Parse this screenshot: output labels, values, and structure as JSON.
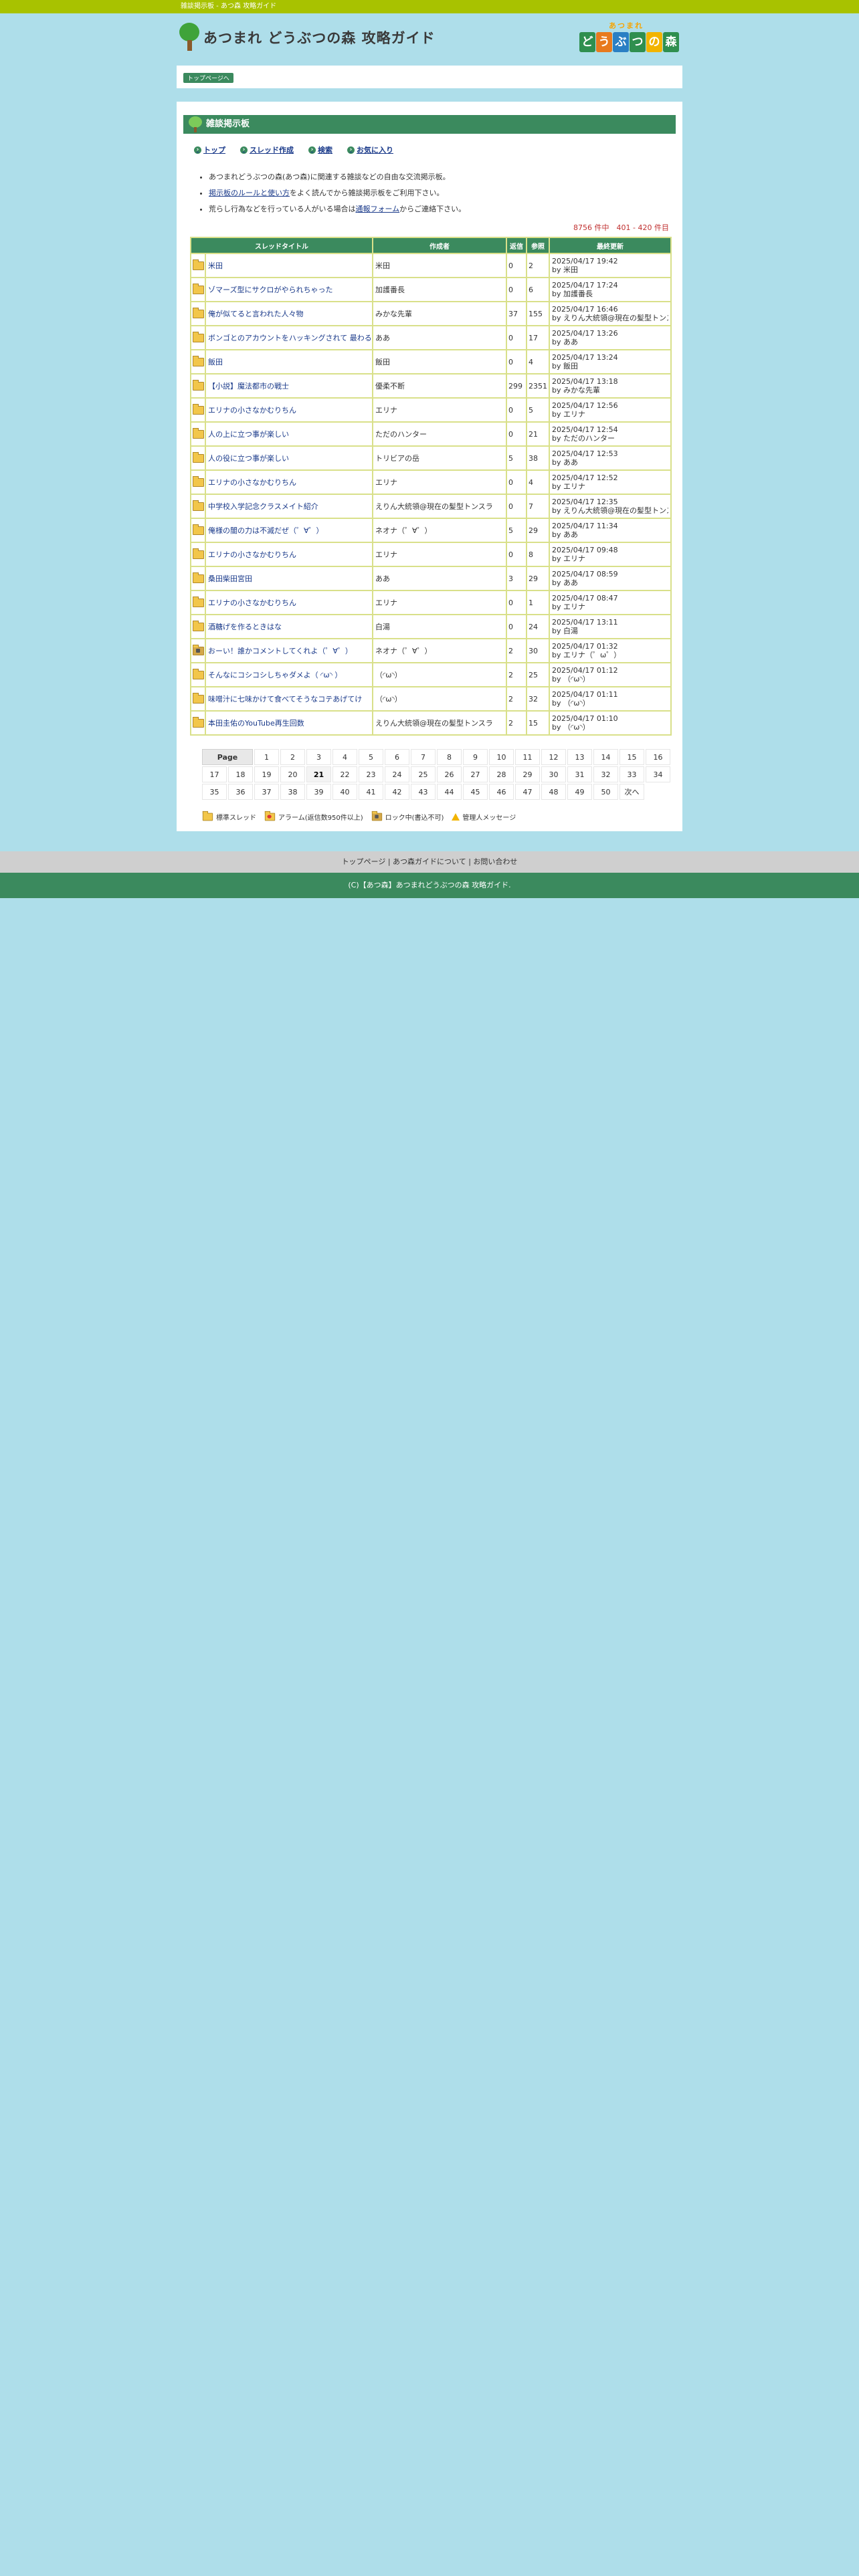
{
  "topbar": {
    "text": "雑談掲示板 - あつ森 攻略ガイド"
  },
  "header": {
    "title": "あつまれ どうぶつの森 攻略ガイド",
    "brand_top": "あつまれ",
    "brand_tiles": [
      {
        "ch": "ど",
        "color": "#2f8f4f"
      },
      {
        "ch": "う",
        "color": "#e87a1e"
      },
      {
        "ch": "ぶ",
        "color": "#2a7fc4"
      },
      {
        "ch": "つ",
        "color": "#2f8f4f"
      },
      {
        "ch": "の",
        "color": "#f2b400"
      },
      {
        "ch": "森",
        "color": "#2f8f4f"
      }
    ]
  },
  "nav": {
    "crumb": "トップページへ"
  },
  "board": {
    "heading": "雑談掲示板",
    "menu": [
      "トップ",
      "スレッド作成",
      "検索",
      "お気に入り"
    ],
    "notes": {
      "n1": "あつまれどうぶつの森(あつ森)に関連する雑談などの自由な交流掲示板。",
      "n2_link": "掲示板のルールと使い方",
      "n2_rest": "をよく読んでから雑談掲示板をご利用下さい。",
      "n3_pre": "荒らし行為などを行っている人がいる場合は",
      "n3_link": "通報フォーム",
      "n3_post": "からご連絡下さい。"
    },
    "count": "8756 件中　401 - 420 件目",
    "columns": [
      "スレッドタイトル",
      "作成者",
      "返信",
      "参照",
      "最終更新"
    ],
    "threads": [
      {
        "icon": "folder",
        "title": "米田",
        "author": "米田",
        "replies": "0",
        "views": "2",
        "date": "2025/04/17 19:42",
        "by": "by 米田"
      },
      {
        "icon": "folder",
        "title": "ゾマーズ型にサクロがやられちゃった",
        "author": "加護番長",
        "replies": "0",
        "views": "6",
        "date": "2025/04/17 17:24",
        "by": "by 加護番長"
      },
      {
        "icon": "folder",
        "title": "俺が似てると言われた人々物",
        "author": "みかな先輩",
        "replies": "37",
        "views": "155",
        "date": "2025/04/17 16:46",
        "by": "by えりん大統領@現在の髪型トンスラ"
      },
      {
        "icon": "folder",
        "title": "ボンゴとのアカウントをハッキングされて \n 最わるう〜くん",
        "author": "ああ",
        "replies": "0",
        "views": "17",
        "date": "2025/04/17 13:26",
        "by": "by ああ"
      },
      {
        "icon": "folder",
        "title": "飯田",
        "author": "飯田",
        "replies": "0",
        "views": "4",
        "date": "2025/04/17 13:24",
        "by": "by 飯田"
      },
      {
        "icon": "folder",
        "title": "【小説】魔法都市の戦士",
        "author": "優柔不断",
        "replies": "299",
        "views": "2351",
        "date": "2025/04/17 13:18",
        "by": "by みかな先輩"
      },
      {
        "icon": "folder",
        "title": "エリナの小さなかむりちん",
        "author": "エリナ",
        "replies": "0",
        "views": "5",
        "date": "2025/04/17 12:56",
        "by": "by エリナ"
      },
      {
        "icon": "folder",
        "title": "人の上に立つ事が楽しい",
        "author": "ただのハンター",
        "replies": "0",
        "views": "21",
        "date": "2025/04/17 12:54",
        "by": "by ただのハンター"
      },
      {
        "icon": "folder",
        "title": "人の役に立つ事が楽しい",
        "author": "トリビアの岳",
        "replies": "5",
        "views": "38",
        "date": "2025/04/17 12:53",
        "by": "by ああ"
      },
      {
        "icon": "folder",
        "title": "エリナの小さなかむりちん",
        "author": "エリナ",
        "replies": "0",
        "views": "4",
        "date": "2025/04/17 12:52",
        "by": "by エリナ"
      },
      {
        "icon": "folder",
        "title": "中学校入学記念クラスメイト紹介",
        "author": "えりん大統領@現在の髪型トンスラ",
        "replies": "0",
        "views": "7",
        "date": "2025/04/17 12:35",
        "by": "by えりん大統領@現在の髪型トンスラ"
      },
      {
        "icon": "folder",
        "title": "俺様の闇の力は不滅だぜ（゜∀゜）",
        "author": "ネオナ（゜∀゜）",
        "replies": "5",
        "views": "29",
        "date": "2025/04/17 11:34",
        "by": "by ああ"
      },
      {
        "icon": "folder",
        "title": "エリナの小さなかむりちん",
        "author": "エリナ",
        "replies": "0",
        "views": "8",
        "date": "2025/04/17 09:48",
        "by": "by エリナ"
      },
      {
        "icon": "folder",
        "title": "桑田柴田宮田",
        "author": "ああ",
        "replies": "3",
        "views": "29",
        "date": "2025/04/17 08:59",
        "by": "by ああ"
      },
      {
        "icon": "folder",
        "title": "エリナの小さなかむりちん",
        "author": "エリナ",
        "replies": "0",
        "views": "1",
        "date": "2025/04/17 08:47",
        "by": "by エリナ"
      },
      {
        "icon": "folder",
        "title": "酒糖げを作るときはな",
        "author": "白湯",
        "replies": "0",
        "views": "24",
        "date": "2025/04/17 13:11",
        "by": "by 白湯"
      },
      {
        "icon": "lock",
        "title": "おーい！誰かコメントしてくれよ（゜∀゜）",
        "author": "ネオナ（゜∀゜）",
        "replies": "2",
        "views": "30",
        "date": "2025/04/17 01:32",
        "by": "by エリナ（゜ω゜）"
      },
      {
        "icon": "folder",
        "title": "そんなにコシコシしちゃダメよ（ ◜ω◝ ）",
        "author": "（◜ω◝）",
        "replies": "2",
        "views": "25",
        "date": "2025/04/17 01:12",
        "by": "by （◜ω◝）"
      },
      {
        "icon": "folder",
        "title": "味噌汁に七味かけて食べてそうなコテあげてけ",
        "author": "（◜ω◝）",
        "replies": "2",
        "views": "32",
        "date": "2025/04/17 01:11",
        "by": "by （◜ω◝）"
      },
      {
        "icon": "folder",
        "title": "本田圭佑のYouTube再生回数",
        "author": "えりん大統領@現在の髪型トンスラ",
        "replies": "2",
        "views": "15",
        "date": "2025/04/17 01:10",
        "by": "by （◜ω◝）"
      }
    ],
    "pager": {
      "label": "Page",
      "rows": [
        [
          "1",
          "2",
          "3",
          "4",
          "5",
          "6",
          "7",
          "8",
          "9",
          "10",
          "11",
          "12",
          "13",
          "14",
          "15",
          "16"
        ],
        [
          "17",
          "18",
          "19",
          "20",
          "21",
          "22",
          "23",
          "24",
          "25",
          "26",
          "27",
          "28",
          "29",
          "30",
          "31",
          "32",
          "33",
          "34"
        ],
        [
          "35",
          "36",
          "37",
          "38",
          "39",
          "40",
          "41",
          "42",
          "43",
          "44",
          "45",
          "46",
          "47",
          "48",
          "49",
          "50",
          "次へ"
        ]
      ],
      "current": "21"
    },
    "legend": [
      "標準スレッド",
      "アラーム(返信数950件以上)",
      "ロック中(書込不可)",
      "管理人メッセージ"
    ]
  },
  "footer": {
    "links": [
      "トップページ",
      "あつ森ガイドについて",
      "お問い合わせ"
    ],
    "sep": " | ",
    "copy": "(C)【あつ森】あつまれどうぶつの森 攻略ガイド."
  }
}
